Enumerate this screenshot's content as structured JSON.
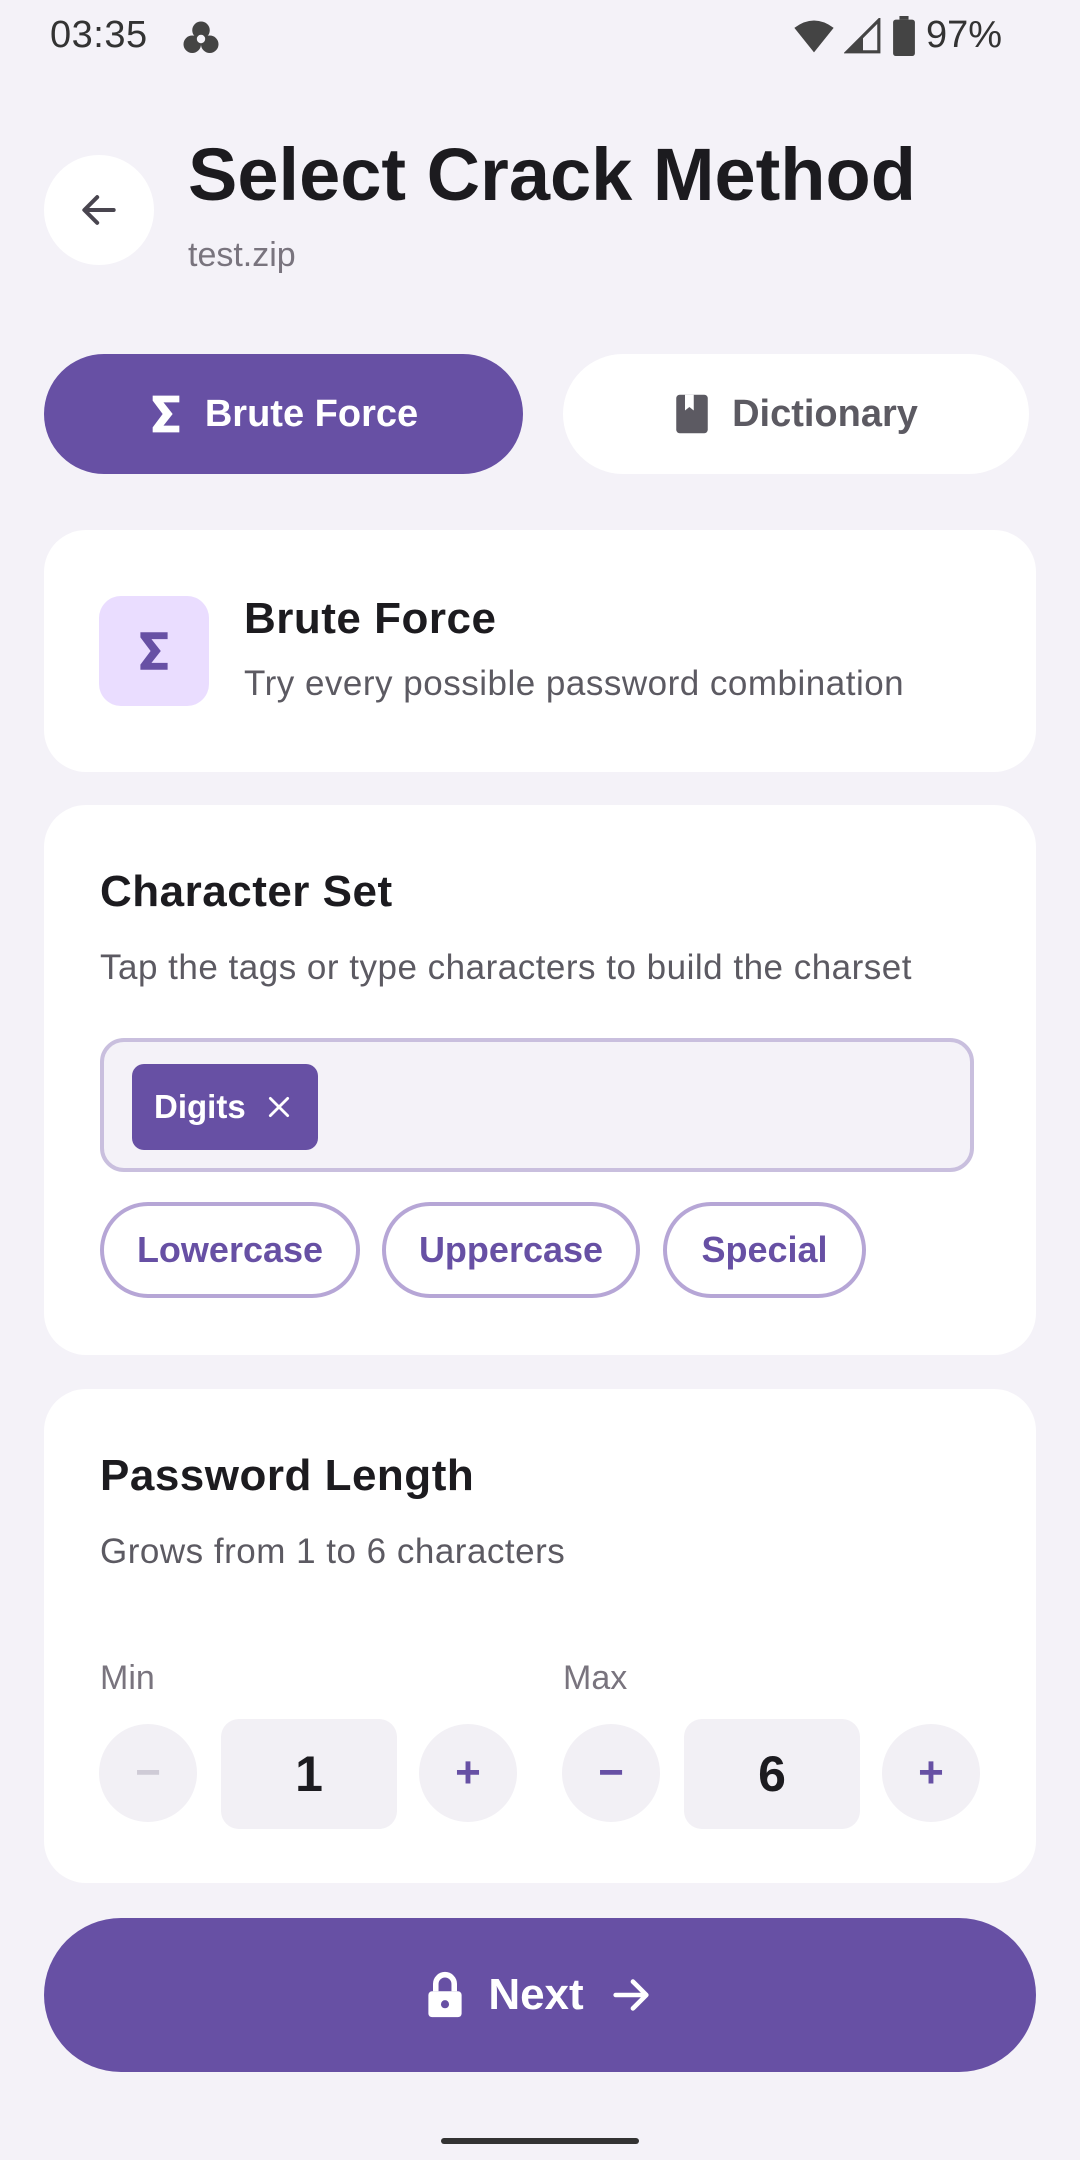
{
  "status": {
    "time": "03:35",
    "battery": "97%"
  },
  "header": {
    "title": "Select Crack Method",
    "file": "test.zip"
  },
  "tabs": [
    {
      "label": "Brute Force",
      "selected": true
    },
    {
      "label": "Dictionary",
      "selected": false
    }
  ],
  "method_card": {
    "title": "Brute Force",
    "description": "Try every possible password combination"
  },
  "charset": {
    "title": "Character Set",
    "description": "Tap the tags or type characters to build the charset",
    "selected_tags": [
      "Digits"
    ],
    "options": [
      "Lowercase",
      "Uppercase",
      "Special"
    ]
  },
  "length": {
    "title": "Password Length",
    "description": "Grows from 1 to 6 characters",
    "min_label": "Min",
    "max_label": "Max",
    "min_value": "1",
    "max_value": "6",
    "minus": "−",
    "plus": "+"
  },
  "next": {
    "label": "Next"
  },
  "colors": {
    "primary": "#6750a4",
    "background": "#f4f2f8",
    "tonal": "#eaddff"
  }
}
